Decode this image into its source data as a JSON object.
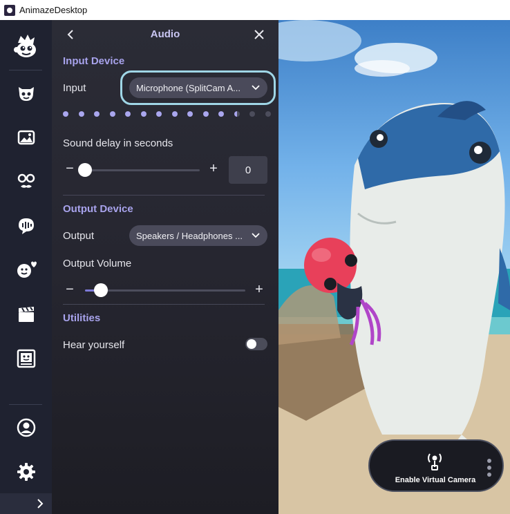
{
  "window": {
    "title": "AnimazeDesktop"
  },
  "sidebar": {
    "items": [
      {
        "icon": "logo-icon"
      },
      {
        "icon": "avatar-face-icon"
      },
      {
        "icon": "background-image-icon"
      },
      {
        "icon": "props-glasses-icon"
      },
      {
        "icon": "speech-bubble-icon"
      },
      {
        "icon": "emotes-icon"
      },
      {
        "icon": "clapperboard-icon"
      },
      {
        "icon": "screen-capture-icon"
      },
      {
        "icon": "profile-icon"
      },
      {
        "icon": "settings-gear-icon"
      },
      {
        "icon": "expand-chevron-icon"
      }
    ]
  },
  "panel": {
    "title": "Audio",
    "input_section": {
      "title": "Input Device",
      "input_label": "Input",
      "input_value": "Microphone (SplitCam A...",
      "level_dots_total": 14,
      "level_dots_active": 11.5
    },
    "sound_delay": {
      "label": "Sound delay in seconds",
      "minus": "−",
      "plus": "+",
      "value": "0",
      "slider_fraction": 0.0
    },
    "output_section": {
      "title": "Output Device",
      "output_label": "Output",
      "output_value": "Speakers / Headphones ...",
      "volume_label": "Output Volume",
      "minus": "−",
      "plus": "+",
      "volume_fraction": 0.1
    },
    "utilities": {
      "title": "Utilities",
      "hear_yourself_label": "Hear yourself",
      "hear_yourself_on": false
    }
  },
  "virtual_camera": {
    "label": "Enable Virtual Camera"
  },
  "colors": {
    "accent": "#a8a3ec",
    "highlight_ring": "#9fd6e6",
    "panel_bg": "#2b2c36",
    "sidebar_bg": "#1f2230"
  }
}
